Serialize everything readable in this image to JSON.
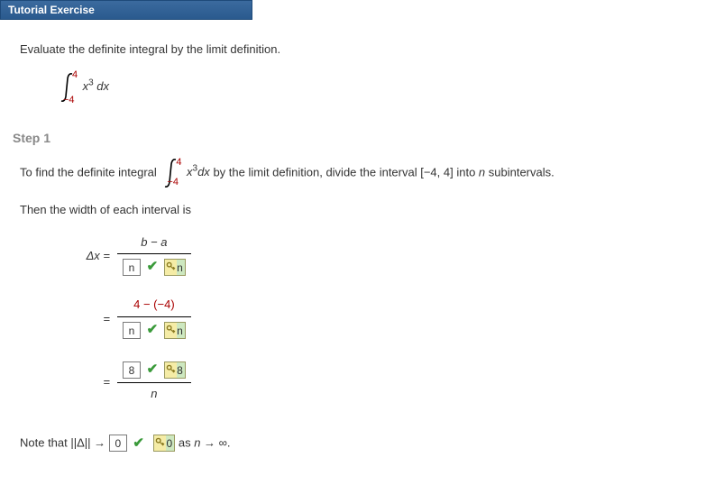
{
  "header": {
    "title": "Tutorial Exercise"
  },
  "prompt": "Evaluate the definite integral by the limit definition.",
  "integral": {
    "upper": "4",
    "lower": "−4",
    "integrand": "x",
    "exp": "3",
    "dx": " dx"
  },
  "step1": {
    "heading": "Step 1",
    "line1_a": "To find the definite integral ",
    "line1_b": " by the limit definition, divide the interval  [−4, 4]  into ",
    "line1_n": "n",
    "line1_c": " subintervals.",
    "line2": "Then the width of each interval is",
    "dx_label": "Δx  =",
    "eq": "=",
    "row1": {
      "num": "b − a",
      "input": "n",
      "key": "n"
    },
    "row2": {
      "num": "4 − (−4)",
      "input": "n",
      "key": "n"
    },
    "row3": {
      "input": "8",
      "key": "8",
      "den": "n"
    },
    "note_a": "Note that  ||Δ|| → ",
    "note_input": "0",
    "note_key": "0",
    "note_b": "  as ",
    "note_n": "n",
    "note_c": " → ∞."
  }
}
